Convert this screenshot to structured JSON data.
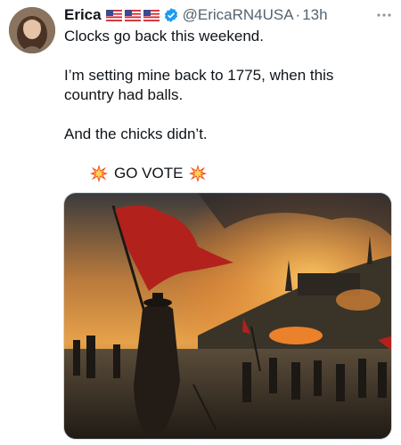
{
  "tweet": {
    "author_name": "Erica",
    "flags": [
      "us-flag-icon",
      "us-flag-icon",
      "us-flag-icon"
    ],
    "handle": "@EricaRN4USA",
    "separator": "·",
    "time": "13h",
    "text_line1": "Clocks go back this weekend.",
    "text_line2": "I’m setting mine back to 1775, when this country had balls.",
    "text_line3": "And the chicks didn’t.",
    "vote_text": "GO VOTE",
    "colors": {
      "verified": "#1d9bf0",
      "muted": "#536471",
      "text": "#0f1419"
    }
  }
}
